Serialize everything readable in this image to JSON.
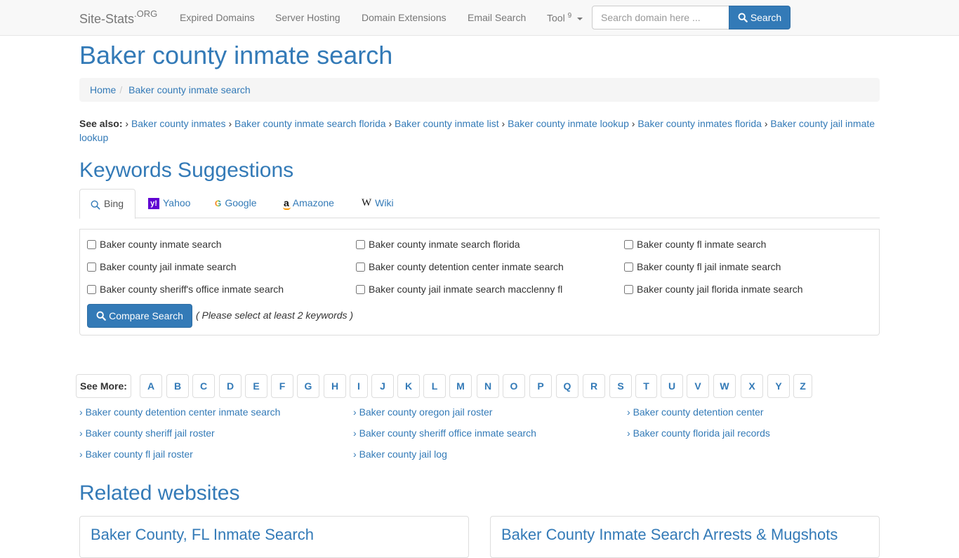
{
  "navbar": {
    "brand": "Site-Stats",
    "brand_sup": ".ORG",
    "items": [
      {
        "label": "Expired Domains"
      },
      {
        "label": "Server Hosting"
      },
      {
        "label": "Domain Extensions"
      },
      {
        "label": "Email Search"
      }
    ],
    "tool_label": "Tool",
    "tool_badge": "9",
    "search_placeholder": "Search domain here ...",
    "search_button": "Search"
  },
  "page": {
    "title": "Baker county inmate search"
  },
  "breadcrumb": {
    "home": "Home",
    "current": "Baker county inmate search"
  },
  "see_also": {
    "label": "See also:",
    "links": [
      "Baker county inmates",
      "Baker county inmate search florida",
      "Baker county inmate list",
      "Baker county inmate lookup",
      "Baker county inmates florida",
      "Baker county jail inmate lookup"
    ]
  },
  "keywords": {
    "title": "Keywords Suggestions",
    "tabs": [
      {
        "label": "Bing",
        "icon": "search-icon",
        "active": true
      },
      {
        "label": "Yahoo",
        "icon": "yahoo-icon"
      },
      {
        "label": "Google",
        "icon": "google-icon"
      },
      {
        "label": "Amazone",
        "icon": "amazon-icon"
      },
      {
        "label": "Wiki",
        "icon": "wikipedia-icon"
      }
    ],
    "items": [
      "Baker county inmate search",
      "Baker county inmate search florida",
      "Baker county fl inmate search",
      "Baker county jail inmate search",
      "Baker county detention center inmate search",
      "Baker county fl jail inmate search",
      "Baker county sheriff's office inmate search",
      "Baker county jail inmate search macclenny fl",
      "Baker county jail florida inmate search"
    ],
    "compare_button": "Compare Search",
    "hint": "( Please select at least 2 keywords )"
  },
  "see_more": {
    "label": "See More:",
    "letters": [
      "A",
      "B",
      "C",
      "D",
      "E",
      "F",
      "G",
      "H",
      "I",
      "J",
      "K",
      "L",
      "M",
      "N",
      "O",
      "P",
      "Q",
      "R",
      "S",
      "T",
      "U",
      "V",
      "W",
      "X",
      "Y",
      "Z"
    ],
    "links": [
      "Baker county detention center inmate search",
      "Baker county oregon jail roster",
      "Baker county detention center",
      "Baker county sheriff jail roster",
      "Baker county sheriff office inmate search",
      "Baker county florida jail records",
      "Baker county fl jail roster",
      "Baker county jail log"
    ]
  },
  "related": {
    "title": "Related websites",
    "sites": [
      {
        "title": "Baker County, FL Inmate Search"
      },
      {
        "title": "Baker County Inmate Search Arrests & Mugshots"
      }
    ]
  },
  "colors": {
    "link": "#337ab7",
    "primary_button": "#337ab7",
    "navbar_bg": "#f8f8f8"
  }
}
